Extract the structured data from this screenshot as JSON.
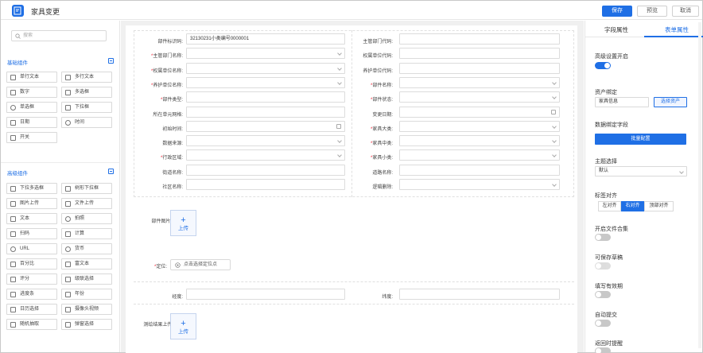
{
  "app": {
    "title": "家具变更"
  },
  "toolbar": {
    "save": "保存",
    "preview": "预览",
    "cancel": "取消"
  },
  "left": {
    "search_placeholder": "搜索",
    "basic_title": "基础组件",
    "basic": [
      "单行文本",
      "多行文本",
      "数字",
      "多选框",
      "单选框",
      "下拉框",
      "日期",
      "时间",
      "开关"
    ],
    "advanced_title": "高级组件",
    "advanced": [
      "下拉多选框",
      "树形下拉框",
      "图片上传",
      "文件上传",
      "文本",
      "拍照",
      "扫码",
      "计算",
      "URL",
      "货币",
      "百分比",
      "富文本",
      "评分",
      "级联选择",
      "进度条",
      "年份",
      "日历选择",
      "摄像头视频",
      "随机抽取",
      "弹窗选择"
    ]
  },
  "form": {
    "rows": [
      {
        "l_label": "部件标识码:",
        "l_req": false,
        "l_value": "32130231小类编号0000001",
        "l_type": "text",
        "r_label": "主管部门代码:",
        "r_req": false,
        "r_value": "",
        "r_type": "text"
      },
      {
        "l_label": "主管部门名称:",
        "l_req": true,
        "l_value": "",
        "l_type": "select",
        "r_label": "权属单位代码:",
        "r_req": false,
        "r_value": "",
        "r_type": "text"
      },
      {
        "l_label": "权属单位名称:",
        "l_req": true,
        "l_value": "",
        "l_type": "select",
        "r_label": "养护单位代码:",
        "r_req": false,
        "r_value": "",
        "r_type": "text"
      },
      {
        "l_label": "养护单位名称:",
        "l_req": true,
        "l_value": "",
        "l_type": "select",
        "r_label": "部件名称:",
        "r_req": true,
        "r_value": "",
        "r_type": "select"
      },
      {
        "l_label": "部件类型:",
        "l_req": true,
        "l_value": "",
        "l_type": "text",
        "r_label": "部件状态:",
        "r_req": true,
        "r_value": "",
        "r_type": "select"
      },
      {
        "l_label": "所在单元网格:",
        "l_req": false,
        "l_value": "",
        "l_type": "text",
        "r_label": "变更日期:",
        "r_req": false,
        "r_value": "",
        "r_type": "date"
      },
      {
        "l_label": "初始时间:",
        "l_req": false,
        "l_value": "",
        "l_type": "date",
        "r_label": "家具大类:",
        "r_req": true,
        "r_value": "",
        "r_type": "select"
      },
      {
        "l_label": "数据来源:",
        "l_req": false,
        "l_value": "",
        "l_type": "select",
        "r_label": "家具中类:",
        "r_req": true,
        "r_value": "",
        "r_type": "select"
      },
      {
        "l_label": "行政区域:",
        "l_req": true,
        "l_value": "",
        "l_type": "select",
        "r_label": "家具小类:",
        "r_req": true,
        "r_value": "",
        "r_type": "select"
      },
      {
        "l_label": "街道名称:",
        "l_req": false,
        "l_value": "",
        "l_type": "text",
        "r_label": "道路名称:",
        "r_req": false,
        "r_value": "",
        "r_type": "text"
      },
      {
        "l_label": "社区名称:",
        "l_req": false,
        "l_value": "",
        "l_type": "text",
        "r_label": "逻辑删除:",
        "r_req": false,
        "r_value": "",
        "r_type": "select"
      }
    ],
    "photo_label": "部件图片:",
    "upload_text": "上传",
    "location_label": "定位:",
    "location_button": "点击选择定位点",
    "lng_label": "经度:",
    "lat_label": "纬度:",
    "survey_label": "测绘结果上传:",
    "upload_text2": "上传"
  },
  "right": {
    "tab_field": "字段属性",
    "tab_form": "表单属性",
    "advanced_enable": "高级设置开启",
    "asset_bind": "资产绑定",
    "asset_value": "家具信息",
    "select_asset": "选择资产",
    "data_bind_field": "数据绑定字段",
    "batch_config": "批量配置",
    "theme": "主题选择",
    "theme_value": "默认",
    "label_align": "标签对齐",
    "align_left": "左对齐",
    "align_right": "右对齐",
    "align_top": "顶部对齐",
    "file_merge": "开启文件合集",
    "save_draft": "可保存草稿",
    "fill_valid": "填写有效期",
    "auto_submit": "自动提交",
    "return_remind": "返回时提醒"
  },
  "colors": {
    "accent": "#1f6fe5",
    "required": "#ee2233"
  }
}
